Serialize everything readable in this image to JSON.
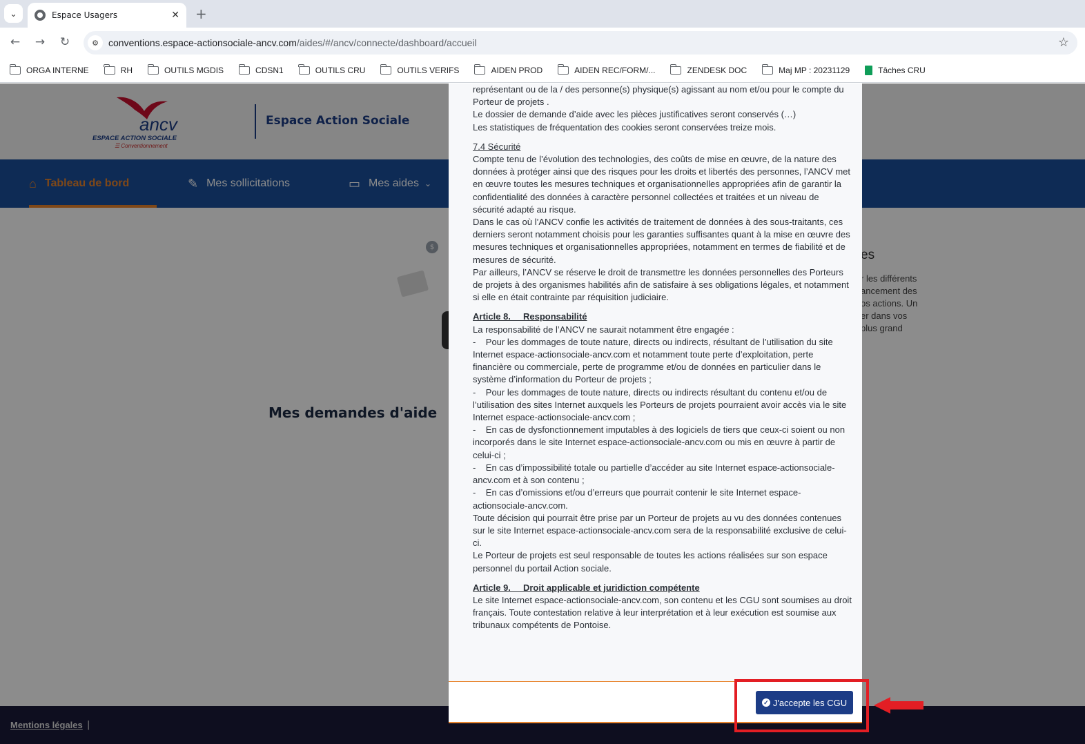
{
  "browser": {
    "tab_title": "Espace Usagers",
    "url_host": "conventions.espace-actionsociale-ancv.com",
    "url_path": "/aides/#/ancv/connecte/dashboard/accueil",
    "bookmarks": [
      "ORGA INTERNE",
      "RH",
      "OUTILS MGDIS",
      "CDSN1",
      "OUTILS CRU",
      "OUTILS VERIFS",
      "AIDEN PROD",
      "AIDEN REC/FORM/...",
      "ZENDESK DOC",
      "Maj MP : 20231129"
    ],
    "bookmark_sheet": "Tâches CRU"
  },
  "header": {
    "logo_word": "ancv",
    "logo_sub": "ESPACE ACTION SOCIALE",
    "logo_sub2": "☰ Conventionnement",
    "site_title": "Espace Action Sociale"
  },
  "nav": {
    "home": "Tableau de bord",
    "requests": "Mes sollicitations",
    "aids": "Mes aides"
  },
  "dashboard": {
    "heading": "Mes demandes d'aide",
    "side_big": "es",
    "side_lines": [
      "r les différents",
      "ancement des",
      "os actions. Un",
      "er dans vos",
      "plus grand"
    ]
  },
  "footer": {
    "legal": "Mentions légales",
    "pipe": "|"
  },
  "modal": {
    "p1": "représentant ou de la / des personne(s) physique(s) agissant au nom et/ou pour le compte du Porteur de projets .",
    "p2": "Le dossier de demande d’aide avec les pièces justificatives seront conservés (…)",
    "p3": "Les statistiques de fréquentation des cookies seront conservées treize mois.",
    "sec74_title": "7.4 Sécurité",
    "sec74_p1": "Compte tenu de l’évolution des technologies, des coûts de mise en œuvre, de la nature des données à protéger ainsi que des risques pour les droits et libertés des personnes, l’ANCV met en œuvre toutes les mesures techniques et organisationnelles appropriées afin de garantir la confidentialité des données à caractère personnel collectées et traitées et un niveau de sécurité adapté au risque.",
    "sec74_p2": "Dans le cas où l’ANCV confie les activités de traitement de données à des sous-traitants, ces derniers seront notamment choisis pour les garanties suffisantes quant à la mise en œuvre des mesures techniques et organisationnelles appropriées, notamment en termes de fiabilité et de mesures de sécurité.",
    "sec74_p3": "Par ailleurs, l’ANCV se réserve le droit de transmettre les données personnelles des Porteurs de projets à des organismes habilités afin de satisfaire à ses obligations légales, et notamment si elle en était contrainte par réquisition judiciaire.",
    "art8_title": "Article 8.     Responsabilité",
    "art8_intro": "La responsabilité de l’ANCV ne saurait notamment être engagée :",
    "art8_items": [
      "-    Pour les dommages de toute nature, directs ou indirects, résultant de l’utilisation du site Internet espace-actionsociale-ancv.com et notamment toute perte d’exploitation, perte financière ou commerciale, perte de programme et/ou de données en particulier dans le système d’information du Porteur de projets ;",
      "-    Pour les dommages de toute nature, directs ou indirects résultant du contenu et/ou de l’utilisation des sites Internet auxquels les Porteurs de projets pourraient avoir accès via le site Internet espace-actionsociale-ancv.com ;",
      "-    En cas de dysfonctionnement imputables à des logiciels de tiers que ceux-ci soient ou non incorporés dans le site Internet espace-actionsociale-ancv.com ou mis en œuvre à partir de celui-ci ;",
      "-    En cas d’impossibilité totale ou partielle d’accéder au site Internet espace-actionsociale-ancv.com et à son contenu ;",
      "-    En cas d’omissions et/ou d’erreurs que pourrait contenir le site Internet espace-actionsociale-ancv.com."
    ],
    "art8_p2": "Toute décision qui pourrait être prise par un Porteur de projets au vu des données contenues sur le site Internet espace-actionsociale-ancv.com sera de la responsabilité exclusive de celui-ci.",
    "art8_p3": "Le Porteur de projets est seul responsable de toutes les actions réalisées sur son espace personnel du portail Action sociale.",
    "art9_title": "Article 9.     Droit applicable et juridiction compétente",
    "art9_p1": "Le site Internet espace-actionsociale-ancv.com, son contenu et les CGU sont soumises au droit français. Toute contestation relative à leur interprétation et à leur exécution est soumise aux tribunaux compétents de Pontoise.",
    "accept_label": "J'accepte les CGU"
  },
  "colors": {
    "brand_blue": "#1c3c86",
    "nav_blue": "#1a4f9c",
    "accent_orange": "#e8842d",
    "annotation_red": "#e31e24"
  }
}
